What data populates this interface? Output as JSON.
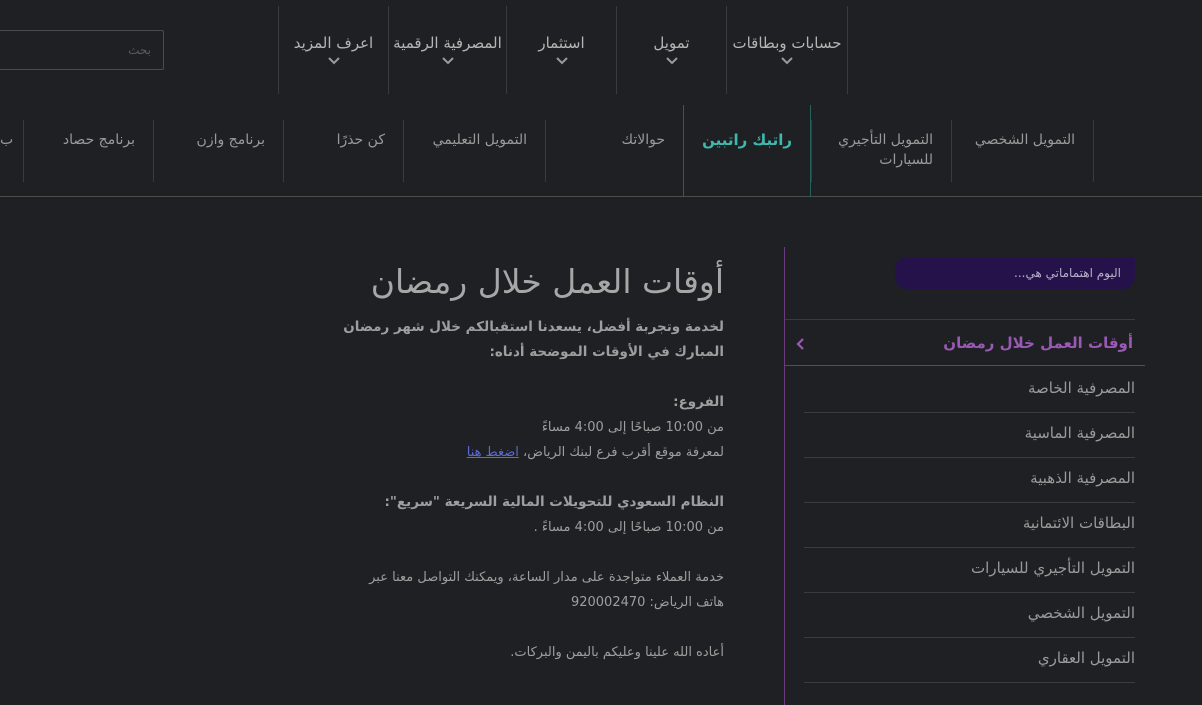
{
  "search": {
    "placeholder": "بحث"
  },
  "topnav": {
    "items": [
      {
        "label": "حسابات وبطاقات"
      },
      {
        "label": "تمويل"
      },
      {
        "label": "استثمار"
      },
      {
        "label": "المصرفية الرقمية"
      },
      {
        "label": "اعرف المزيد"
      }
    ]
  },
  "subnav": {
    "items": [
      {
        "label": "التمويل الشخصي"
      },
      {
        "label": "التمويل التأجيري للسيارات"
      },
      {
        "label": "راتبك راتبين"
      },
      {
        "label": "حوالاتك"
      },
      {
        "label": "التمويل التعليمي"
      },
      {
        "label": "كن حذرًا"
      },
      {
        "label": "برنامج وازن"
      },
      {
        "label": "برنامج حصاد"
      },
      {
        "label": "ب"
      }
    ],
    "active_index": 2,
    "active_color": "#3fb8ad"
  },
  "sidebar": {
    "interest_label": "اليوم اهتماماتي هي...",
    "active_item": "أوقات العمل خلال رمضان",
    "active_color": "#9b59b6",
    "items": [
      "المصرفية الخاصة",
      "المصرفية الماسية",
      "المصرفية الذهبية",
      "البطاقات الائتمانية",
      "التمويل التأجيري للسيارات",
      "التمويل الشخصي",
      "التمويل العقاري"
    ]
  },
  "content": {
    "title": "أوقات العمل خلال رمضان",
    "intro": "لخدمة وتجربة أفضل، يسعدنا استقبالكم خلال شهر رمضان المبارك في الأوقات الموضحة أدناه:",
    "branches_heading": "الفروع:",
    "branches_hours": "من 10:00 صباحًا إلى 4:00 مساءً",
    "branch_locator_text": "لمعرفة موقع أقرب فرع لبنك الرياض،",
    "branch_locator_link": "اضغط هنا",
    "sarie_heading": "النظام السعودي للتحويلات المالية السريعة \"سريع\":",
    "sarie_hours": "من 10:00 صباحًا إلى 4:00 مساءً .",
    "customer_service_line1": "خدمة العملاء متواجدة على مدار الساعة، ويمكنك التواصل معنا عبر",
    "customer_service_line2": "هاتف الرياض: 920002470",
    "closing": "أعاده الله علينا وعليكم باليمن والبركات."
  }
}
